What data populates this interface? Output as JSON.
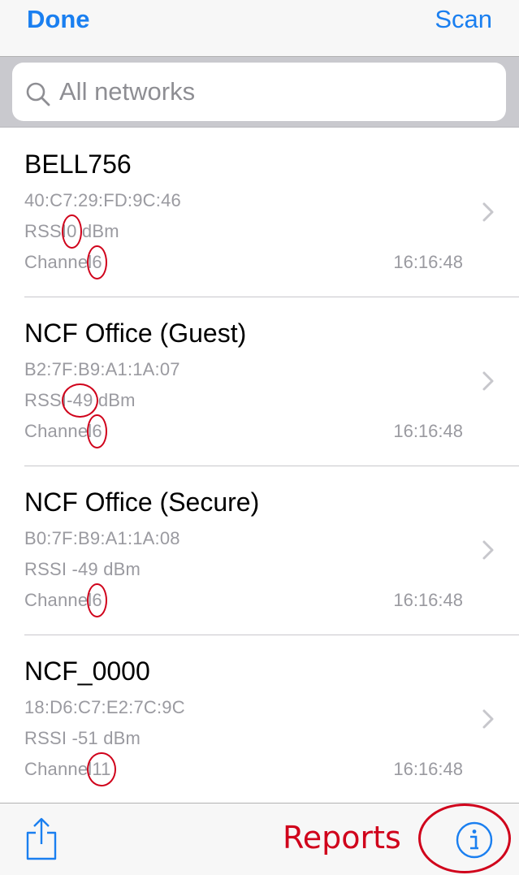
{
  "navbar": {
    "done_label": "Done",
    "scan_label": "Scan"
  },
  "search": {
    "placeholder": "All networks",
    "icon": "search-icon"
  },
  "networks": [
    {
      "name": "BELL756",
      "bssid": "40:C7:29:FD:9C:46",
      "rssi_prefix": "RSSI",
      "rssi_value": "0",
      "rssi_unit": "dBm",
      "channel_prefix": "Channel",
      "channel_value": "6",
      "time": "16:16:48"
    },
    {
      "name": "NCF Office (Guest)",
      "bssid": "B2:7F:B9:A1:1A:07",
      "rssi_prefix": "RSSI",
      "rssi_value": "-49",
      "rssi_unit": "dBm",
      "channel_prefix": "Channel",
      "channel_value": "6",
      "time": "16:16:48"
    },
    {
      "name": "NCF Office (Secure)",
      "bssid": "B0:7F:B9:A1:1A:08",
      "rssi_prefix": "RSSI",
      "rssi_value": "-49",
      "rssi_unit": "dBm",
      "channel_prefix": "Channel",
      "channel_value": "6",
      "time": "16:16:48"
    },
    {
      "name": "NCF_0000",
      "bssid": "18:D6:C7:E2:7C:9C",
      "rssi_prefix": "RSSI",
      "rssi_value": "-51",
      "rssi_unit": "dBm",
      "channel_prefix": "Channel",
      "channel_value": "11",
      "time": "16:16:48"
    }
  ],
  "toolbar": {
    "share_icon": "share-icon",
    "reports_annotation": "Reports",
    "info_icon": "info-icon"
  },
  "colors": {
    "accent": "#1a7ff0",
    "annotation": "#d0021b",
    "secondary_text": "#9a9aa0"
  }
}
